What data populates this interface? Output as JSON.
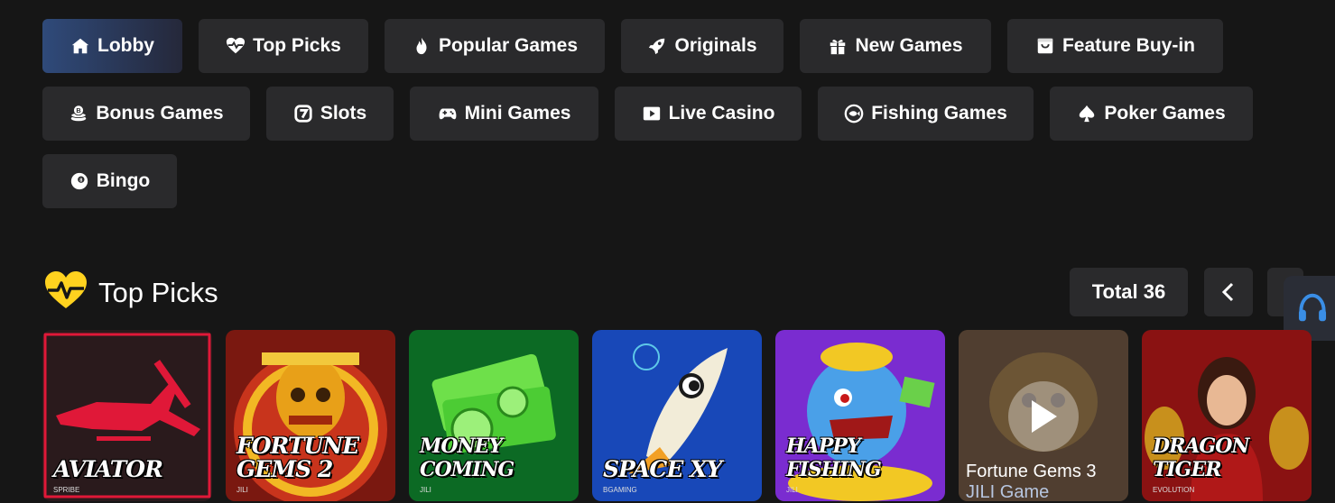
{
  "categories": {
    "row1": [
      {
        "label": "Lobby",
        "icon": "home-icon",
        "active": true
      },
      {
        "label": "Top Picks",
        "icon": "heart-pulse-icon"
      },
      {
        "label": "Popular Games",
        "icon": "fire-icon"
      },
      {
        "label": "Originals",
        "icon": "rocket-icon"
      },
      {
        "label": "New Games",
        "icon": "gift-icon"
      },
      {
        "label": "Feature Buy-in",
        "icon": "bag-icon"
      }
    ],
    "row2": [
      {
        "label": "Bonus Games",
        "icon": "coin-stack-icon"
      },
      {
        "label": "Slots",
        "icon": "slot-seven-icon"
      },
      {
        "label": "Mini Games",
        "icon": "gamepad-icon"
      },
      {
        "label": "Live Casino",
        "icon": "video-icon"
      },
      {
        "label": "Fishing Games",
        "icon": "fish-icon"
      },
      {
        "label": "Poker Games",
        "icon": "spade-icon"
      }
    ],
    "row3": [
      {
        "label": "Bingo",
        "icon": "bingo-ball-icon"
      }
    ]
  },
  "section": {
    "title": "Top Picks",
    "total_label": "Total 36"
  },
  "cards": [
    {
      "title": "AVIATOR",
      "provider": "SPRIBE"
    },
    {
      "title": "FORTUNE GEMS 2",
      "provider": "JILI"
    },
    {
      "title": "MONEY COMING",
      "provider": "JILI"
    },
    {
      "title": "SPACE XY",
      "provider": "BGAMING"
    },
    {
      "title": "HAPPY FISHING",
      "provider": "JILI"
    },
    {
      "title": "Fortune Gems 3",
      "provider": "JILI Game"
    },
    {
      "title": "DRAGON TIGER",
      "provider": "EVOLUTION"
    }
  ],
  "colors": {
    "background": "#161616",
    "button": "#2a2a2c",
    "active_button": "#2f4a7a",
    "heart": "#ffd21f",
    "support_icon": "#3a8ee6"
  }
}
